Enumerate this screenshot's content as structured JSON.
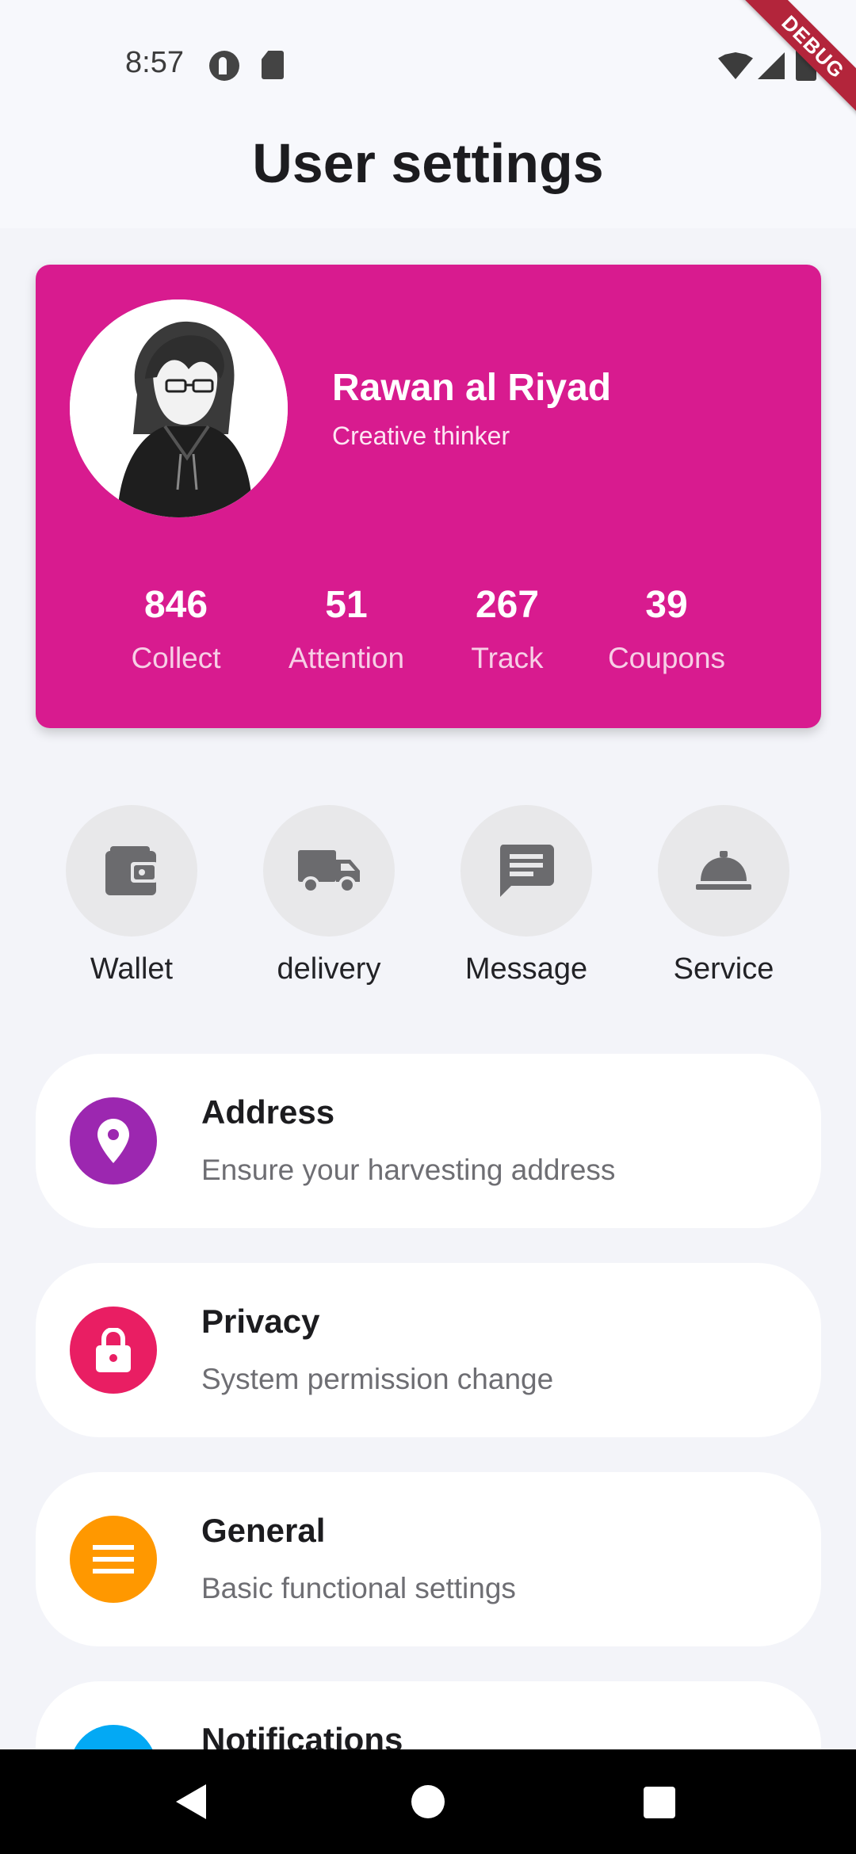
{
  "status_bar": {
    "time": "8:57",
    "icons": [
      "r-app-icon",
      "sd-card-icon",
      "wifi-icon",
      "signal-icon",
      "battery-icon"
    ]
  },
  "debug_banner": "DEBUG",
  "header": {
    "title": "User settings"
  },
  "profile": {
    "name": "Rawan al Riyad",
    "tagline": "Creative thinker",
    "card_color": "#d81b8f",
    "stats": [
      {
        "value": "846",
        "label": "Collect"
      },
      {
        "value": "51",
        "label": "Attention"
      },
      {
        "value": "267",
        "label": "Track"
      },
      {
        "value": "39",
        "label": "Coupons"
      }
    ]
  },
  "quick_actions": [
    {
      "label": "Wallet",
      "icon": "wallet-icon"
    },
    {
      "label": "delivery",
      "icon": "truck-icon"
    },
    {
      "label": "Message",
      "icon": "message-icon"
    },
    {
      "label": "Service",
      "icon": "service-bell-icon"
    }
  ],
  "settings": [
    {
      "title": "Address",
      "subtitle": "Ensure your harvesting address",
      "icon": "location-pin-icon",
      "color": "#9c27b0"
    },
    {
      "title": "Privacy",
      "subtitle": "System permission change",
      "icon": "lock-icon",
      "color": "#e91e63"
    },
    {
      "title": "General",
      "subtitle": "Basic functional settings",
      "icon": "menu-icon",
      "color": "#ff9800"
    },
    {
      "title": "Notifications",
      "subtitle": "",
      "icon": "notification-icon",
      "color": "#03a9f4"
    }
  ],
  "nav_bar": {
    "buttons": [
      "back-icon",
      "home-icon",
      "recents-icon"
    ]
  }
}
